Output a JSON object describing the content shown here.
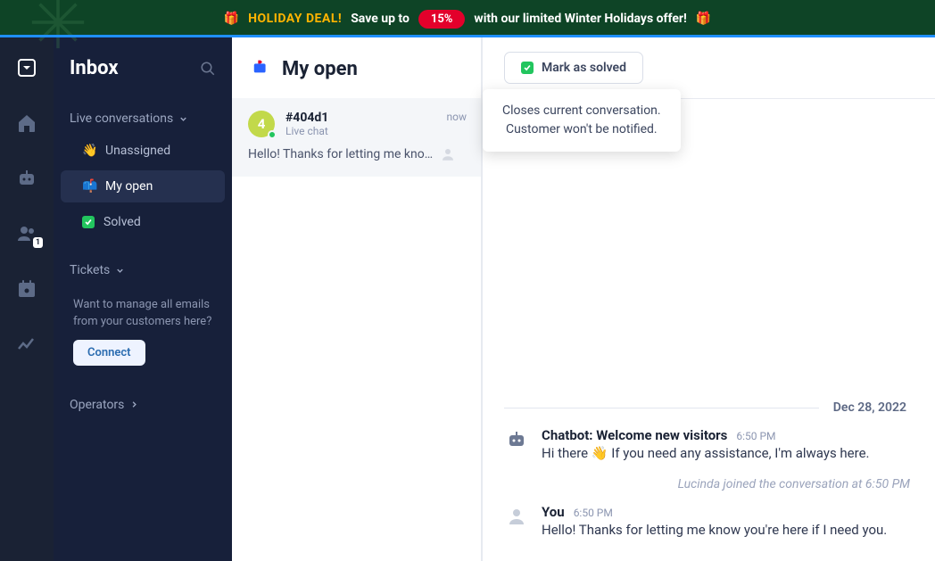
{
  "banner": {
    "deal": "HOLIDAY DEAL!",
    "pre": "Save up to",
    "pct": "15%",
    "post": "with our limited Winter Holidays offer!",
    "gift": "🎁"
  },
  "sidebar": {
    "title": "Inbox",
    "sections": {
      "live": "Live conversations",
      "tickets": "Tickets",
      "operators": "Operators"
    },
    "items": {
      "unassigned": "Unassigned",
      "myopen": "My open",
      "solved": "Solved"
    },
    "tickets_promo": "Want to manage all emails from your customers here?",
    "connect": "Connect",
    "rail_badge": "1"
  },
  "list": {
    "title": "My open",
    "conv": {
      "avatar_char": "4",
      "id": "#404d1",
      "channel": "Live chat",
      "time": "now",
      "preview": "Hello! Thanks for letting me kno…"
    }
  },
  "chat": {
    "solve_label": "Mark as solved",
    "tooltip_line1": "Closes current conversation.",
    "tooltip_line2": "Customer won't be notified.",
    "date": "Dec 28, 2022",
    "bot": {
      "author": "Chatbot: Welcome new visitors",
      "time": "6:50 PM",
      "pre": "Hi there",
      "emoji": "👋",
      "post": "If you need any assistance, I'm always here."
    },
    "system": "Lucinda joined the conversation at 6:50 PM",
    "you": {
      "author": "You",
      "time": "6:50 PM",
      "text": "Hello! Thanks for letting me know you're here if I need you."
    }
  }
}
